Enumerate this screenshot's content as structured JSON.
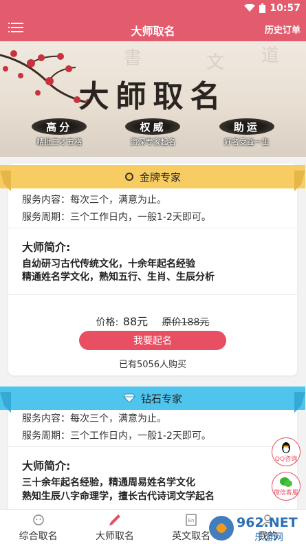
{
  "status": {
    "time": "10:57"
  },
  "appbar": {
    "title": "大师取名",
    "history": "历史订单"
  },
  "banner": {
    "title": "大師取名",
    "badges": [
      {
        "label": "高分",
        "sub": "精批三才五格"
      },
      {
        "label": "权威",
        "sub": "资深专家起名"
      },
      {
        "label": "助运",
        "sub": "好名受益一生"
      }
    ]
  },
  "gold": {
    "ribbon": "金牌专家",
    "service": "服务内容：每次三个，满意为止。",
    "period": "服务周期：三个工作日内，一般1-2天即可。",
    "intro_title": "大师简介:",
    "intro_lines": [
      "自幼研习古代传统文化，十余年起名经验",
      "精通姓名学文化，熟知五行、生肖、生辰分析"
    ],
    "price_label": "价格:",
    "price": "88元",
    "original": "原价188元",
    "buy": "我要起名",
    "sold": "已有5056人购买"
  },
  "diamond": {
    "ribbon": "钻石专家",
    "service": "服务内容：每次三个，满意为止。",
    "period": "服务周期：三个工作日内，一般1-2天即可。",
    "intro_title": "大师简介:",
    "intro_lines": [
      "三十余年起名经验，精通周易姓名学文化",
      "熟知生辰八字命理学，擅长古代诗词文学起名"
    ]
  },
  "floats": {
    "qq": "QQ咨询",
    "wechat": "微信客服"
  },
  "tabs": [
    "综合取名",
    "大师取名",
    "英文取名",
    "我的"
  ],
  "watermark": "962.NET 乐游网",
  "colors": {
    "primary": "#e35c6e",
    "gold_ribbon": "#f7cd63",
    "diamond_ribbon": "#4fc5ee",
    "button": "#e84f62"
  }
}
